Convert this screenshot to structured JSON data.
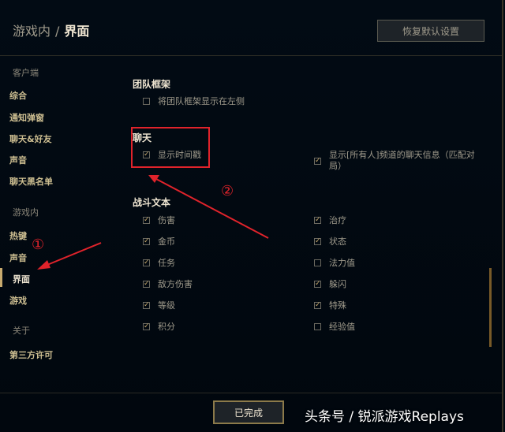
{
  "header": {
    "breadcrumb_parent": "游戏内",
    "breadcrumb_sep": "/",
    "breadcrumb_current": "界面",
    "reset_label": "恢复默认设置"
  },
  "sidebar": {
    "client_header": "客户端",
    "client_items": [
      "综合",
      "通知弹窗",
      "聊天&好友",
      "声音",
      "聊天黑名单"
    ],
    "ingame_header": "游戏内",
    "ingame_items": [
      "热键",
      "声音",
      "界面",
      "游戏"
    ],
    "about_header": "关于",
    "about_items": [
      "第三方许可"
    ],
    "active_item": "界面"
  },
  "team_frame": {
    "title": "团队框架",
    "option": {
      "label": "将团队框架显示在左侧",
      "checked": false
    }
  },
  "chat": {
    "title": "聊天",
    "left_option": {
      "label": "显示时间戳",
      "checked": true
    },
    "right_option": {
      "label": "显示[所有人]频道的聊天信息（匹配对局）",
      "checked": true
    }
  },
  "combat_text": {
    "title": "战斗文本",
    "left_options": [
      {
        "label": "伤害",
        "checked": true
      },
      {
        "label": "金币",
        "checked": true
      },
      {
        "label": "任务",
        "checked": true
      },
      {
        "label": "敌方伤害",
        "checked": true
      },
      {
        "label": "等级",
        "checked": true
      },
      {
        "label": "积分",
        "checked": true
      }
    ],
    "right_options": [
      {
        "label": "治疗",
        "checked": true
      },
      {
        "label": "状态",
        "checked": true
      },
      {
        "label": "法力值",
        "checked": false
      },
      {
        "label": "躲闪",
        "checked": true
      },
      {
        "label": "特殊",
        "checked": true
      },
      {
        "label": "经验值",
        "checked": false
      }
    ]
  },
  "footer": {
    "done_label": "已完成"
  },
  "annotations": {
    "marker_1": "①",
    "marker_2": "②",
    "color": "#e0232b"
  },
  "watermark": "头条号 / 锐派游戏Replays",
  "colors": {
    "gold": "#c8aa6e",
    "background": "#010a13",
    "text": "#a09b8c"
  }
}
